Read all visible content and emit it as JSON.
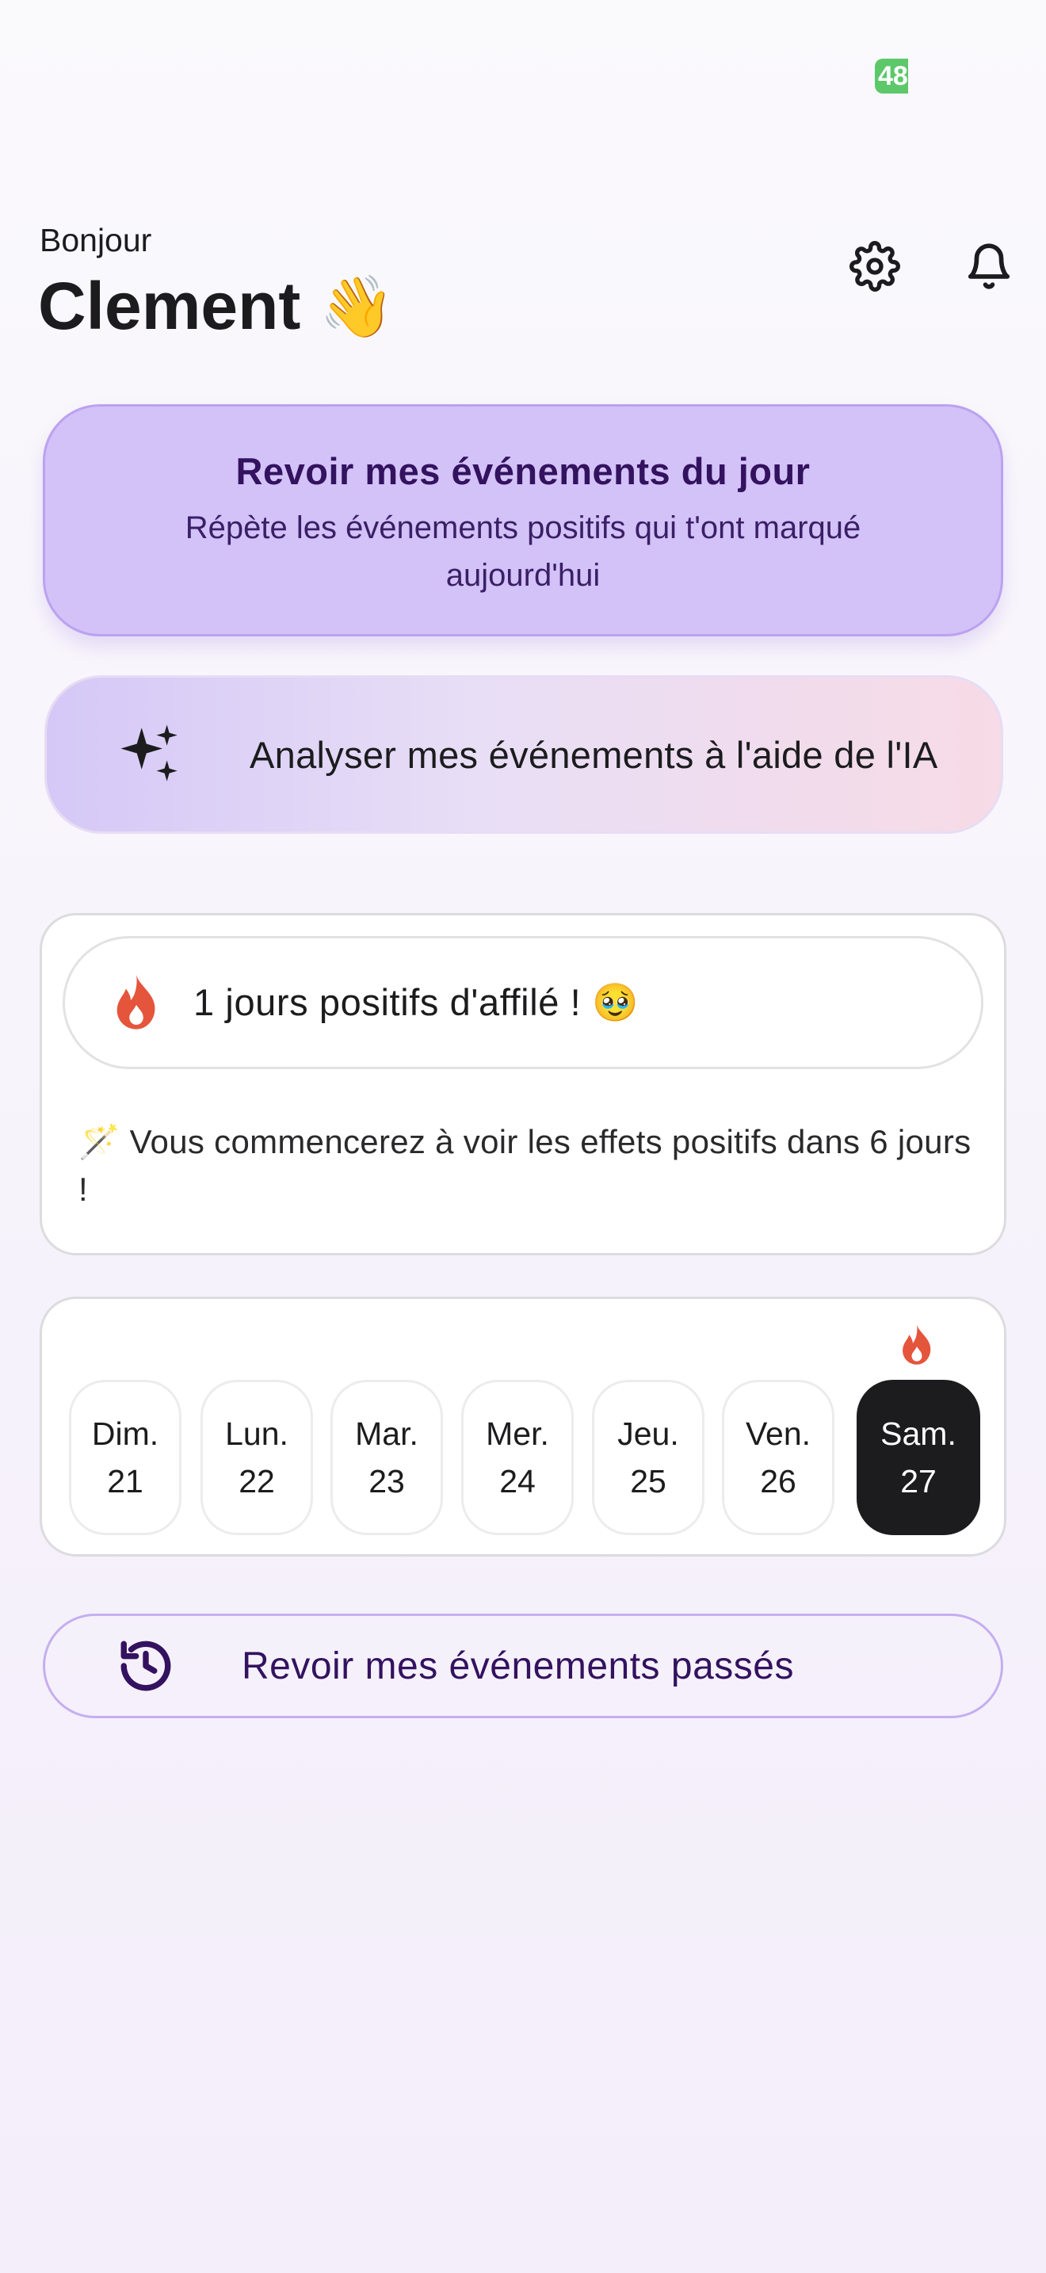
{
  "status_bar": {
    "battery_badge": "48"
  },
  "header": {
    "greeting": "Bonjour",
    "user_name": "Clement",
    "wave_emoji": "👋",
    "icons": [
      "gear-icon",
      "bell-icon"
    ]
  },
  "review_today": {
    "title": "Revoir mes événements du jour",
    "subtitle": "Répète les événements positifs qui t'ont marqué aujourd'hui"
  },
  "ai_analyze": {
    "label": "Analyser mes événements à l'aide de l'IA",
    "icon": "sparkle-icon"
  },
  "streak": {
    "text": "1 jours positifs d'affilé ! 🥹",
    "message": "🪄  Vous commencerez à voir les effets positifs dans 6 jours !",
    "icon": "flame-icon"
  },
  "week": {
    "days": [
      {
        "name": "Dim.",
        "num": "21"
      },
      {
        "name": "Lun.",
        "num": "22"
      },
      {
        "name": "Mar.",
        "num": "23"
      },
      {
        "name": "Mer.",
        "num": "24"
      },
      {
        "name": "Jeu.",
        "num": "25"
      },
      {
        "name": "Ven.",
        "num": "26"
      },
      {
        "name": "Sam.",
        "num": "27"
      }
    ],
    "active_index": 6
  },
  "past_events": {
    "label": "Revoir mes événements passés",
    "icon": "history-icon"
  },
  "colors": {
    "accent_purple": "#d3c2f7",
    "dark_purple_text": "#33125f",
    "flame": "#e4553c",
    "battery_green": "#5cc86a"
  }
}
